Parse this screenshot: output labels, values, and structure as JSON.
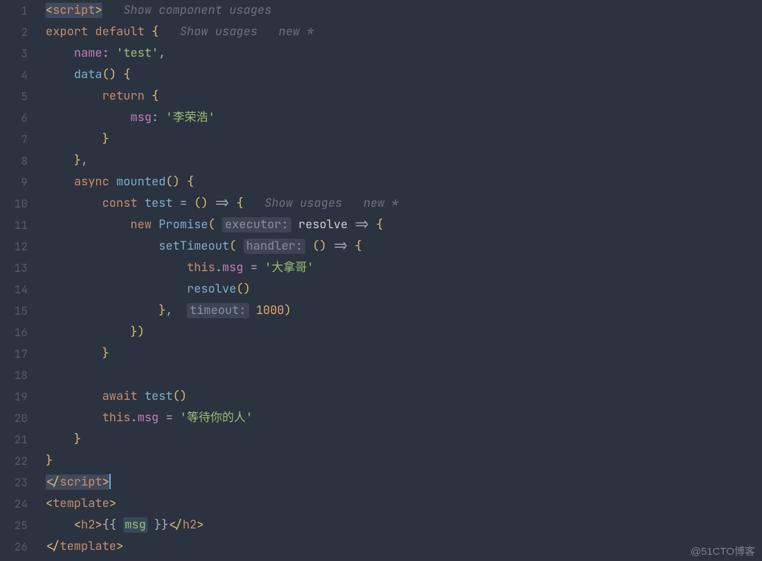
{
  "lines": [
    "1",
    "2",
    "3",
    "4",
    "5",
    "6",
    "7",
    "8",
    "9",
    "10",
    "11",
    "12",
    "13",
    "14",
    "15",
    "16",
    "17",
    "18",
    "19",
    "20",
    "21",
    "22",
    "23",
    "24",
    "25",
    "26"
  ],
  "code": {
    "l1": {
      "open": "<",
      "tag": "script",
      "close": ">"
    },
    "hints": {
      "showComponentUsages": "Show component usages",
      "showUsages": "Show usages",
      "newStar": "new *"
    },
    "l2": {
      "export": "export",
      "default": "default",
      "brace": "{"
    },
    "l3": {
      "name": "name",
      "colon": ":",
      "val": "'test'",
      "comma": ","
    },
    "l4": {
      "data": "data",
      "parens": "()",
      "brace": "{"
    },
    "l5": {
      "return": "return",
      "brace": "{"
    },
    "l6": {
      "msg": "msg",
      "colon": ":",
      "val": "'李荣浩'"
    },
    "l7": {
      "brace": "}"
    },
    "l8": {
      "brace": "}",
      "comma": ","
    },
    "l9": {
      "async": "async",
      "mounted": "mounted",
      "parens": "()",
      "brace": "{"
    },
    "l10": {
      "const": "const",
      "test": "test",
      "eq": "=",
      "parens": "()",
      "arrow": "=>",
      "brace": "{"
    },
    "l11": {
      "new": "new",
      "promise": "Promise",
      "open": "(",
      "inlay": "executor:",
      "resolve": "resolve",
      "arrow": "=>",
      "brace": "{"
    },
    "l12": {
      "setTimeout": "setTimeout",
      "open": "(",
      "inlay": "handler:",
      "parens": "()",
      "arrow": "=>",
      "brace": "{"
    },
    "l13": {
      "this": "this",
      "dot": ".",
      "msg": "msg",
      "eq": "=",
      "val": "'大拿哥'"
    },
    "l14": {
      "resolve": "resolve",
      "parens": "()"
    },
    "l15": {
      "brace": "}",
      "comma": ",",
      "inlay": "timeout:",
      "num": "1000",
      "close": ")"
    },
    "l16": {
      "text": "})"
    },
    "l17": {
      "brace": "}"
    },
    "l19": {
      "await": "await",
      "test": "test",
      "parens": "()"
    },
    "l20": {
      "this": "this",
      "dot": ".",
      "msg": "msg",
      "eq": "=",
      "val": "'等待你的人'"
    },
    "l21": {
      "brace": "}"
    },
    "l22": {
      "brace": "}"
    },
    "l23": {
      "open": "</",
      "tag": "script",
      "close": ">"
    },
    "l24": {
      "open": "<",
      "tag": "template",
      "close": ">"
    },
    "l25": {
      "open": "<",
      "h2": "h2",
      "gt": ">",
      "dlb": "{{",
      "msg": "msg",
      "drb": "}}",
      "close": "</",
      "gt2": ">"
    },
    "l26": {
      "open": "</",
      "tag": "template",
      "close": ">"
    }
  },
  "watermark": "@51CTO博客"
}
